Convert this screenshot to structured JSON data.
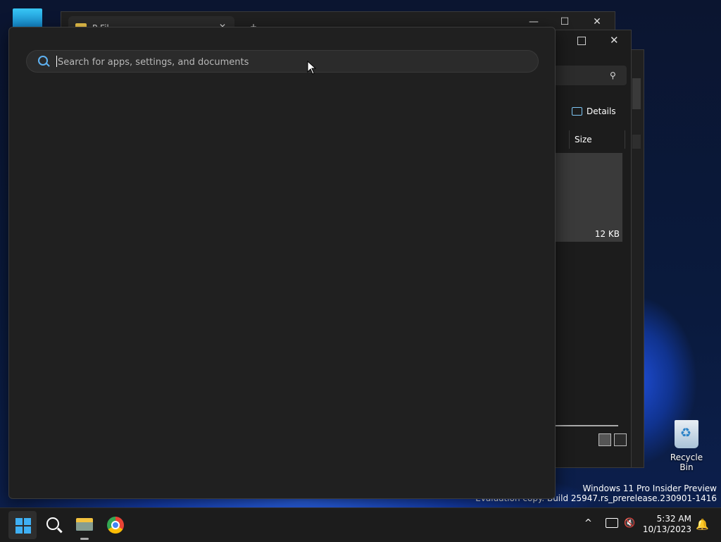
{
  "search": {
    "placeholder": "Search for apps, settings, and documents",
    "value": ""
  },
  "explorer_back": {
    "tab_label": "P      Fil",
    "tab_close": "✕",
    "new_tab": "+",
    "minimize": "—",
    "maximize": "☐",
    "close": "✕"
  },
  "explorer_front": {
    "close": "✕",
    "details_label": "Details",
    "column_size": "Size",
    "file_size": "12 KB"
  },
  "desktop": {
    "recycle_bin_label": "Recycle Bin",
    "watermark_line1": "Windows 11 Pro Insider Preview",
    "watermark_line2": "Evaluation copy. Build 25947.rs_prerelease.230901-1416"
  },
  "taskbar": {
    "time": "5:32 AM",
    "date": "10/13/2023",
    "icons": [
      "windows-start-icon",
      "search-icon",
      "file-explorer-icon",
      "chrome-icon"
    ],
    "tray_chevron": "^",
    "notification_icon": "bell-icon"
  },
  "colors": {
    "flyout_bg": "#202020",
    "accent": "#3fb0f4",
    "taskbar_bg": "#1c1c1c"
  }
}
